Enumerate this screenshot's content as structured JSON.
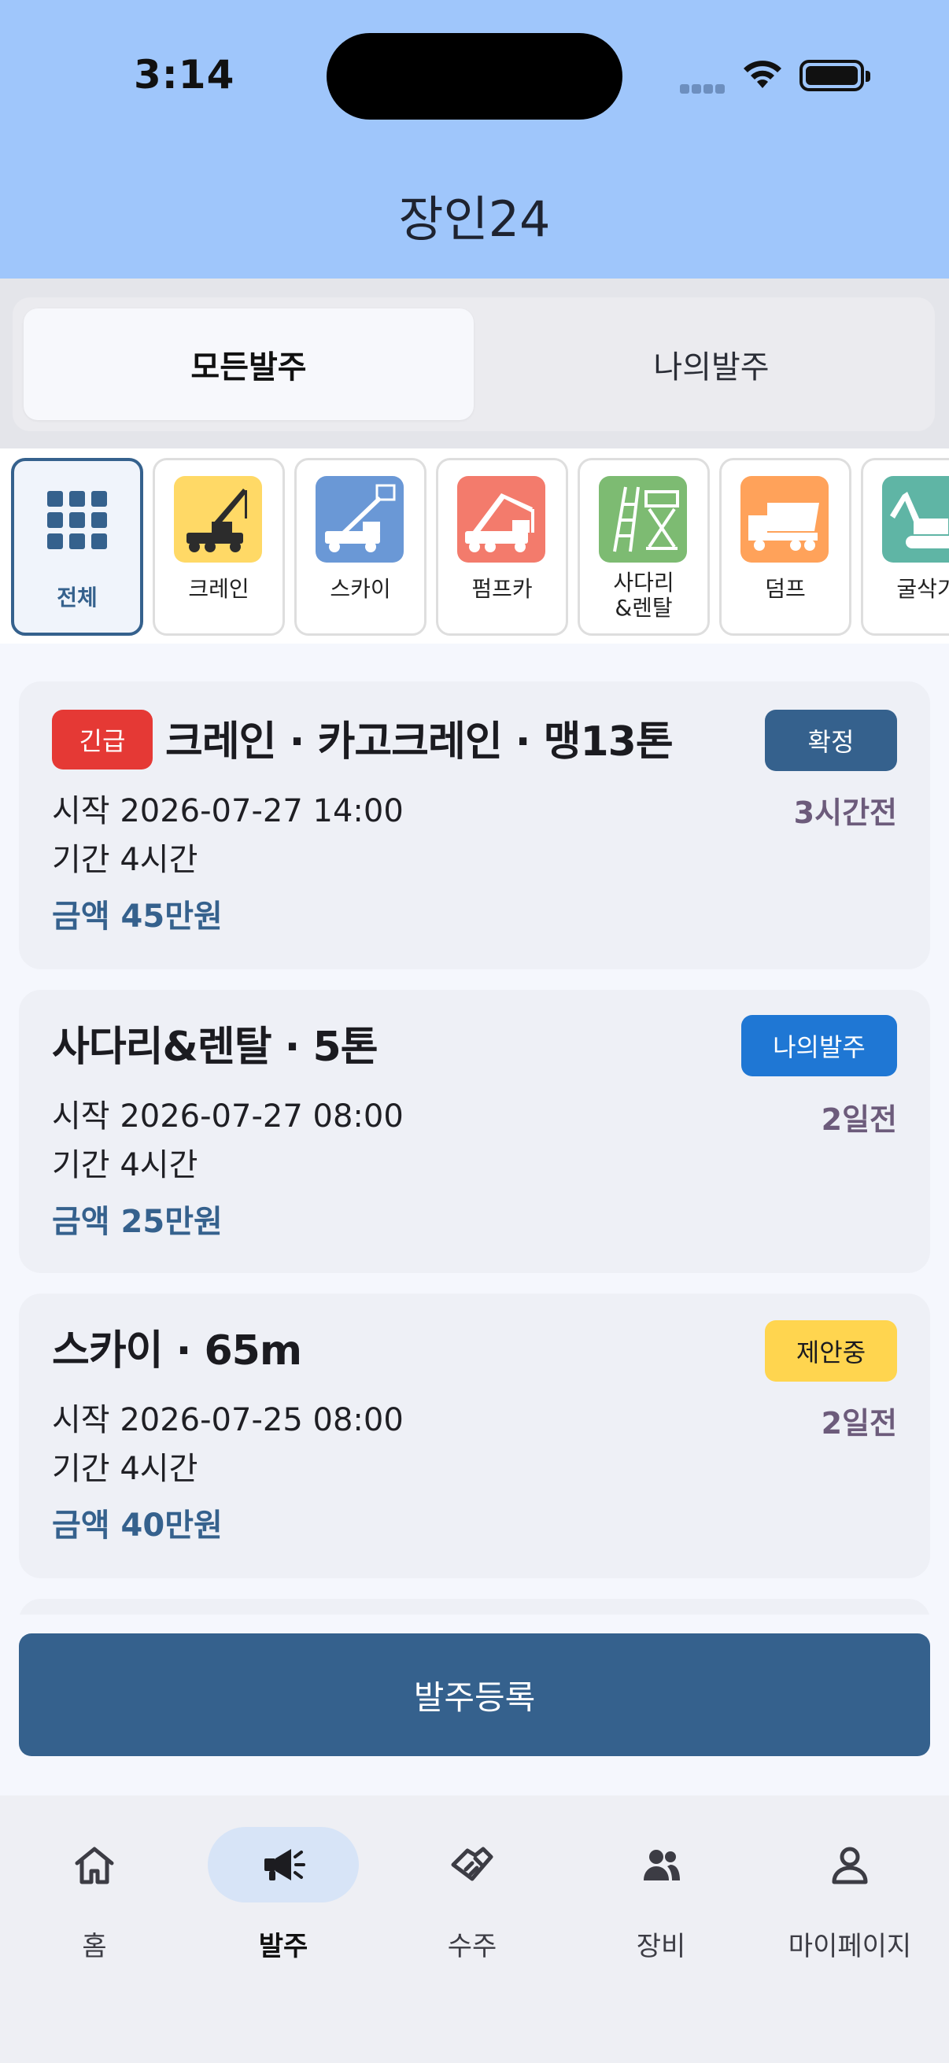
{
  "status_bar": {
    "time": "3:14"
  },
  "app": {
    "title": "장인24"
  },
  "segment": {
    "all_orders": "모든발주",
    "my_orders": "나의발주"
  },
  "categories": [
    {
      "label": "전체",
      "icon": "grid-icon",
      "color": "#ffffff"
    },
    {
      "label": "크레인",
      "icon": "crane-icon",
      "color": "#ffd966"
    },
    {
      "label": "스카이",
      "icon": "sky-lift-icon",
      "color": "#6a98d6"
    },
    {
      "label": "펌프카",
      "icon": "pump-truck-icon",
      "color": "#f37b6c"
    },
    {
      "label": "사다리\n&렌탈",
      "icon": "ladder-icon",
      "color": "#7dbb72"
    },
    {
      "label": "덤프",
      "icon": "dump-truck-icon",
      "color": "#ffa25a"
    },
    {
      "label": "굴삭기",
      "icon": "excavator-icon",
      "color": "#5fb5a5"
    }
  ],
  "orders": [
    {
      "urgent": "긴급",
      "title": "크레인 · 카고크레인 · 맹13톤",
      "badge": "확정",
      "ago": "3시간전",
      "start": "시작 2026-07-27 14:00",
      "duration": "기간 4시간",
      "amount": "금액 45만원"
    },
    {
      "title": "사다리&렌탈 · 5톤",
      "badge": "나의발주",
      "ago": "2일전",
      "start": "시작 2026-07-27 08:00",
      "duration": "기간 4시간",
      "amount": "금액 25만원"
    },
    {
      "title": "스카이 · 65m",
      "badge": "제안중",
      "ago": "2일전",
      "start": "시작 2026-07-25 08:00",
      "duration": "기간 4시간",
      "amount": "금액 40만원"
    }
  ],
  "cta": {
    "label": "발주등록"
  },
  "tabs": [
    {
      "label": "홈",
      "icon": "home-icon"
    },
    {
      "label": "발주",
      "icon": "megaphone-icon"
    },
    {
      "label": "수주",
      "icon": "handshake-icon"
    },
    {
      "label": "장비",
      "icon": "group-icon"
    },
    {
      "label": "마이페이지",
      "icon": "person-icon"
    }
  ],
  "colors": {
    "primary": "#35618d",
    "header_bg": "#9fc6fb",
    "urgent": "#e53935",
    "mine_badge": "#1f77d4",
    "proposal_badge": "#ffd54f"
  }
}
